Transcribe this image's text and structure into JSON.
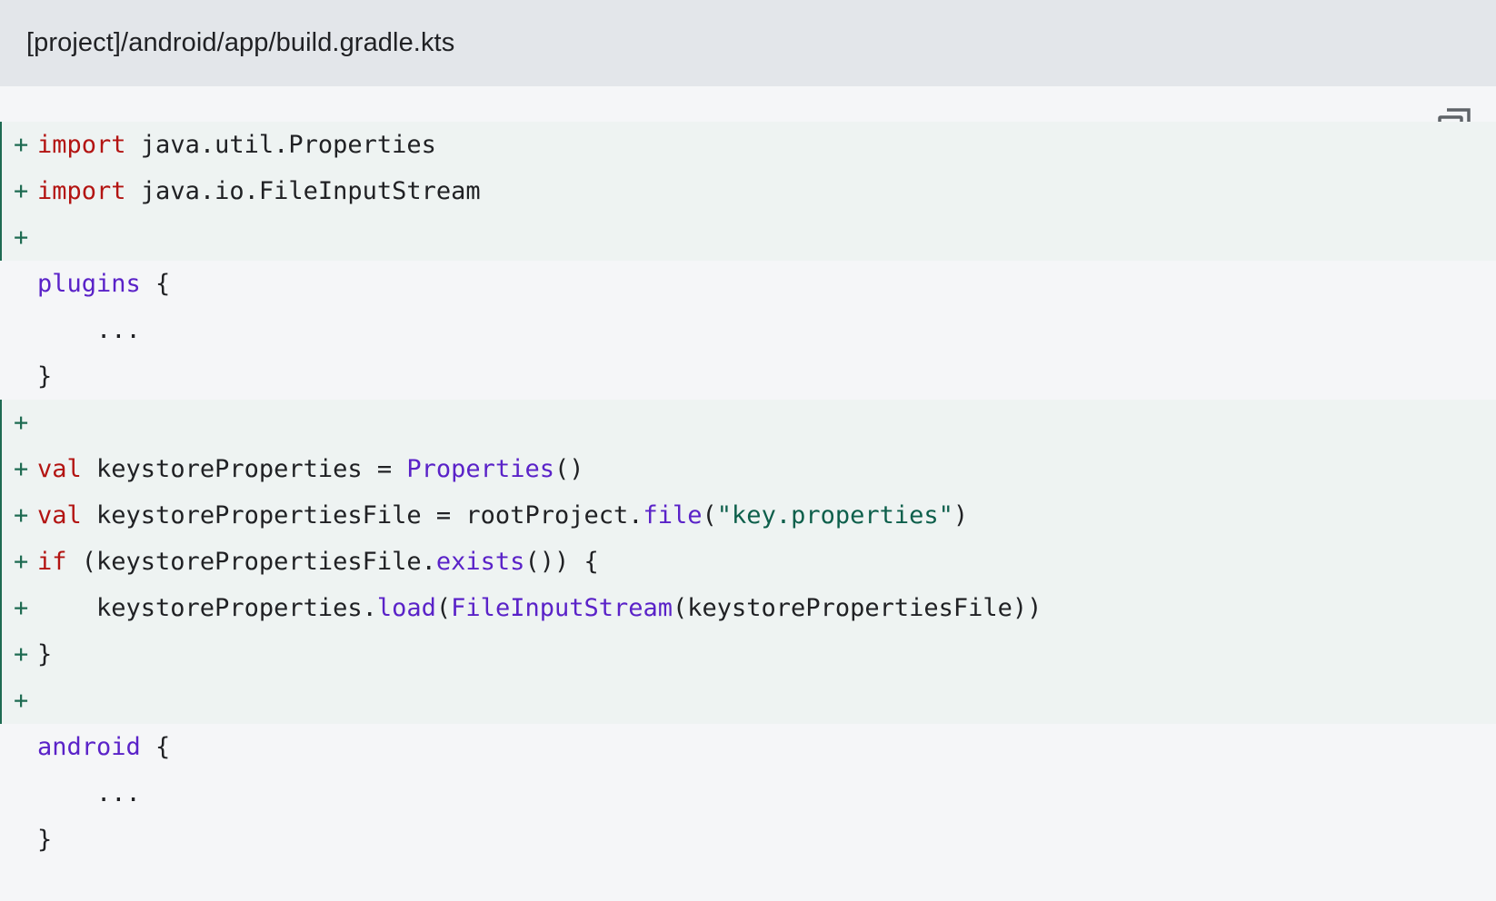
{
  "file_path": "[project]/android/app/build.gradle.kts",
  "copy_icon": "copy-icon",
  "colors": {
    "header_bg": "#e3e6ea",
    "code_bg": "#f5f6f8",
    "added_bg": "#eef3f2",
    "added_marker": "#1e6b52",
    "keyword": "#b31412",
    "function": "#5a22c8",
    "string": "#0d5f4b"
  },
  "diff_marker": "+",
  "code_lines": [
    {
      "added": true,
      "tokens": [
        {
          "t": "import",
          "c": "kw"
        },
        {
          "t": " java.util.Properties",
          "c": ""
        }
      ]
    },
    {
      "added": true,
      "tokens": [
        {
          "t": "import",
          "c": "kw"
        },
        {
          "t": " java.io.FileInputStream",
          "c": ""
        }
      ]
    },
    {
      "added": true,
      "tokens": []
    },
    {
      "added": false,
      "tokens": [
        {
          "t": "plugins",
          "c": "fn"
        },
        {
          "t": " {",
          "c": ""
        }
      ]
    },
    {
      "added": false,
      "tokens": [
        {
          "t": "    ...",
          "c": ""
        }
      ]
    },
    {
      "added": false,
      "tokens": [
        {
          "t": "}",
          "c": ""
        }
      ]
    },
    {
      "added": true,
      "tokens": []
    },
    {
      "added": true,
      "tokens": [
        {
          "t": "val",
          "c": "kw"
        },
        {
          "t": " keystoreProperties = ",
          "c": ""
        },
        {
          "t": "Properties",
          "c": "fn"
        },
        {
          "t": "()",
          "c": ""
        }
      ]
    },
    {
      "added": true,
      "tokens": [
        {
          "t": "val",
          "c": "kw"
        },
        {
          "t": " keystorePropertiesFile = rootProject.",
          "c": ""
        },
        {
          "t": "file",
          "c": "fn"
        },
        {
          "t": "(",
          "c": ""
        },
        {
          "t": "\"key.properties\"",
          "c": "str"
        },
        {
          "t": ")",
          "c": ""
        }
      ]
    },
    {
      "added": true,
      "tokens": [
        {
          "t": "if",
          "c": "kw"
        },
        {
          "t": " (keystorePropertiesFile.",
          "c": ""
        },
        {
          "t": "exists",
          "c": "fn"
        },
        {
          "t": "()) {",
          "c": ""
        }
      ]
    },
    {
      "added": true,
      "tokens": [
        {
          "t": "    keystoreProperties.",
          "c": ""
        },
        {
          "t": "load",
          "c": "fn"
        },
        {
          "t": "(",
          "c": ""
        },
        {
          "t": "FileInputStream",
          "c": "fn"
        },
        {
          "t": "(keystorePropertiesFile))",
          "c": ""
        }
      ]
    },
    {
      "added": true,
      "tokens": [
        {
          "t": "}",
          "c": ""
        }
      ]
    },
    {
      "added": true,
      "tokens": []
    },
    {
      "added": false,
      "tokens": [
        {
          "t": "android",
          "c": "fn"
        },
        {
          "t": " {",
          "c": ""
        }
      ]
    },
    {
      "added": false,
      "tokens": [
        {
          "t": "    ...",
          "c": ""
        }
      ]
    },
    {
      "added": false,
      "tokens": [
        {
          "t": "}",
          "c": ""
        }
      ]
    }
  ]
}
